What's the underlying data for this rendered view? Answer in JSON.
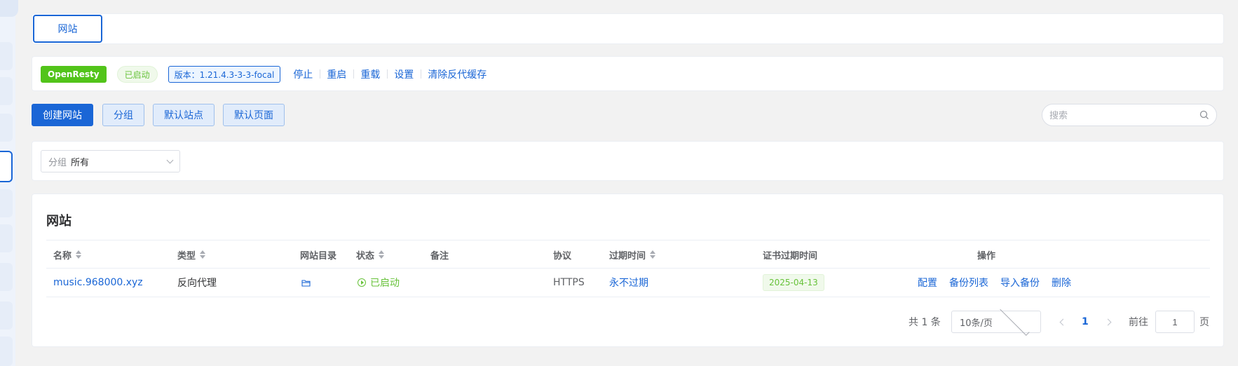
{
  "tabs": [
    {
      "label": "网站",
      "active": true
    }
  ],
  "server": {
    "name": "OpenResty",
    "status": "已启动",
    "version": "版本：1.21.4.3-3-3-focal",
    "actions": [
      "停止",
      "重启",
      "重载",
      "设置",
      "清除反代缓存"
    ]
  },
  "toolbar": {
    "create": "创建网站",
    "group": "分组",
    "default_site": "默认站点",
    "default_page": "默认页面",
    "search_placeholder": "搜索"
  },
  "filter": {
    "group_label": "分组",
    "group_value": "所有"
  },
  "table": {
    "title": "网站",
    "columns": [
      "名称",
      "类型",
      "网站目录",
      "状态",
      "备注",
      "协议",
      "过期时间",
      "证书过期时间",
      "操作"
    ],
    "sortable": [
      "名称",
      "类型",
      "状态",
      "过期时间"
    ],
    "rows": [
      {
        "name": "music.968000.xyz",
        "type": "反向代理",
        "dir_icon": "folder-icon",
        "status": "已启动",
        "remark": "",
        "protocol": "HTTPS",
        "expire": "永不过期",
        "cert_expire": "2025-04-13",
        "ops": [
          "配置",
          "备份列表",
          "导入备份",
          "删除"
        ]
      }
    ]
  },
  "pagination": {
    "total_text": "共 1 条",
    "page_size": "10条/页",
    "current_page": "1",
    "goto_label": "前往",
    "goto_value": "1",
    "page_suffix": "页"
  },
  "colors": {
    "primary": "#1a66d6",
    "success": "#67c23a",
    "server_tag": "#52c41a"
  }
}
